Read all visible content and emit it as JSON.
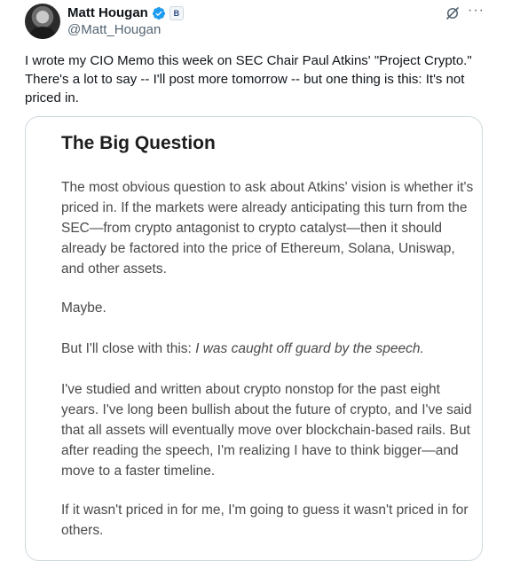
{
  "author": {
    "display_name": "Matt Hougan",
    "handle": "@Matt_Hougan",
    "verified_icon": "verified-badge-icon",
    "affiliate_icon": "affiliate-badge-icon",
    "affiliate_glyph": "B"
  },
  "actions": {
    "grok_icon": "grok-icon",
    "more_glyph": "···"
  },
  "tweet": {
    "text": "I wrote my CIO Memo this week on SEC Chair Paul Atkins' \"Project Crypto.\"   There's a lot to say -- I'll post more tomorrow -- but one thing is this: It's not priced in."
  },
  "card": {
    "title": "The Big Question",
    "paragraph_1": "The most obvious question to ask about Atkins' vision is whether it's priced in. If the markets were already anticipating this turn from the SEC—from crypto antagonist to crypto catalyst—then it should already be factored into the price of Ethereum, Solana, Uniswap, and other assets.",
    "paragraph_2": "Maybe.",
    "paragraph_3_lead": "But I'll close with this: ",
    "paragraph_3_quote": "I was caught off guard by the speech.",
    "paragraph_4": "I've studied and written about crypto nonstop for the past eight years. I've long been bullish about the future of crypto, and I've said that all assets will eventually move over blockchain-based rails. But after reading the speech, I'm realizing I have to think bigger—and move to a faster timeline.",
    "paragraph_5": "If it wasn't priced in for me, I'm going to guess it wasn't priced in for others."
  },
  "colors": {
    "text_primary": "#0f1419",
    "text_secondary": "#536471",
    "verified_blue": "#1d9bf0",
    "card_border": "#cfd9de"
  }
}
